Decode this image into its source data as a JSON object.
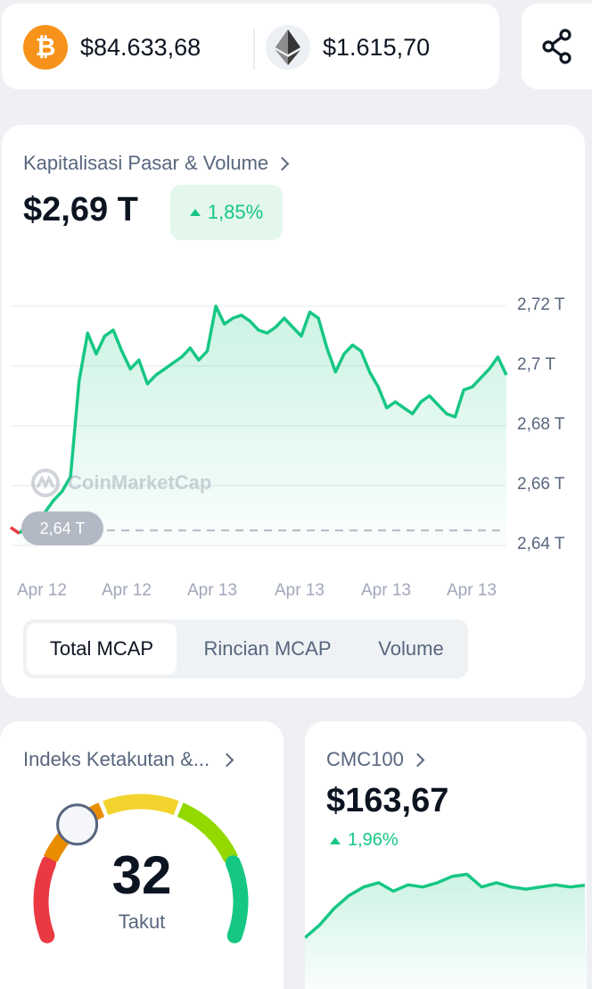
{
  "ticker": {
    "btc": {
      "icon": "bitcoin-icon",
      "symbol": "₿",
      "price": "$84.633,68"
    },
    "eth": {
      "icon": "ethereum-icon",
      "price": "$1.615,70"
    },
    "share_icon": "share-icon"
  },
  "market_cap": {
    "title": "Kapitalisasi Pasar & Volume",
    "value": "$2,69 T",
    "change": "1,85%",
    "baseline_label": "2,64 T",
    "watermark": "CoinMarketCap",
    "y_ticks": [
      "2,72 T",
      "2,7 T",
      "2,68 T",
      "2,66 T",
      "2,64 T"
    ],
    "x_ticks": [
      "Apr 12",
      "Apr 12",
      "Apr 13",
      "Apr 13",
      "Apr 13",
      "Apr 13"
    ],
    "tabs": [
      "Total MCAP",
      "Rincian MCAP",
      "Volume"
    ],
    "active_tab": "Total MCAP",
    "accent_color": "#16c784",
    "down_color": "#ea3943"
  },
  "chart_data": [
    {
      "type": "area",
      "title": "Kapitalisasi Pasar & Volume",
      "x": [
        "Apr 12",
        "Apr 12",
        "Apr 13",
        "Apr 13",
        "Apr 13",
        "Apr 13"
      ],
      "y_unit": "T",
      "ylim": [
        2.64,
        2.725
      ],
      "baseline": 2.645,
      "series": [
        {
          "values": [
            2.646,
            2.644,
            2.647,
            2.648,
            2.651,
            2.655,
            2.658,
            2.663,
            2.695,
            2.711,
            2.704,
            2.71,
            2.712,
            2.705,
            2.699,
            2.702,
            2.694,
            2.697,
            2.699,
            2.701,
            2.703,
            2.706,
            2.702,
            2.705,
            2.72,
            2.714,
            2.716,
            2.717,
            2.715,
            2.712,
            2.711,
            2.713,
            2.716,
            2.713,
            2.71,
            2.718,
            2.716,
            2.706,
            2.698,
            2.704,
            2.707,
            2.705,
            2.698,
            2.693,
            2.686,
            2.688,
            2.686,
            2.684,
            2.688,
            2.69,
            2.687,
            2.684,
            2.683,
            2.692,
            2.693,
            2.696,
            2.699,
            2.703,
            2.697
          ]
        }
      ],
      "grid": true
    },
    {
      "type": "area",
      "title": "CMC100",
      "series": [
        {
          "values": [
            150.0,
            153.0,
            157.0,
            160.0,
            162.0,
            163.0,
            161.0,
            162.5,
            162.0,
            163.0,
            164.5,
            165.0,
            162.0,
            163.0,
            162.0,
            161.5,
            162.0,
            162.5,
            162.0,
            162.4
          ]
        }
      ],
      "grid": false
    }
  ],
  "fear_greed": {
    "title": "Indeks Ketakutan &...",
    "value": "32",
    "label": "Takut",
    "level": 0.32,
    "segment_colors": [
      "#ea3943",
      "#ea8c00",
      "#f3d42f",
      "#93d900",
      "#16c784"
    ]
  },
  "cmc100": {
    "title": "CMC100",
    "value": "$163,67",
    "change": "1,96%"
  }
}
